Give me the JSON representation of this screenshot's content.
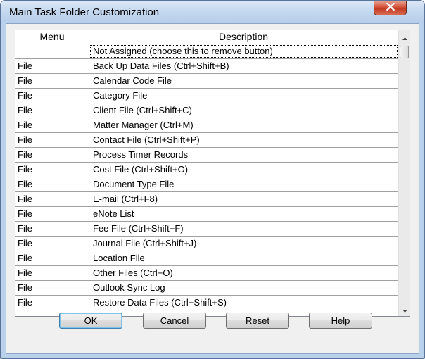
{
  "window": {
    "title": "Main Task Folder Customization",
    "close_symbol": "✕"
  },
  "table": {
    "columns": [
      "Menu",
      "Description"
    ],
    "rows": [
      {
        "menu": "",
        "description": "Not Assigned (choose this to remove button)"
      },
      {
        "menu": "File",
        "description": "Back Up Data Files (Ctrl+Shift+B)"
      },
      {
        "menu": "File",
        "description": "Calendar Code File"
      },
      {
        "menu": "File",
        "description": "Category File"
      },
      {
        "menu": "File",
        "description": "Client File (Ctrl+Shift+C)"
      },
      {
        "menu": "File",
        "description": "Matter Manager (Ctrl+M)"
      },
      {
        "menu": "File",
        "description": "Contact File (Ctrl+Shift+P)"
      },
      {
        "menu": "File",
        "description": "Process Timer Records"
      },
      {
        "menu": "File",
        "description": "Cost File (Ctrl+Shift+O)"
      },
      {
        "menu": "File",
        "description": "Document Type File"
      },
      {
        "menu": "File",
        "description": "E-mail (Ctrl+F8)"
      },
      {
        "menu": "File",
        "description": "eNote List"
      },
      {
        "menu": "File",
        "description": "Fee File (Ctrl+Shift+F)"
      },
      {
        "menu": "File",
        "description": "Journal File (Ctrl+Shift+J)"
      },
      {
        "menu": "File",
        "description": "Location File"
      },
      {
        "menu": "File",
        "description": "Other Files (Ctrl+O)"
      },
      {
        "menu": "File",
        "description": "Outlook Sync Log"
      },
      {
        "menu": "File",
        "description": "Restore Data Files (Ctrl+Shift+S)"
      }
    ]
  },
  "buttons": {
    "ok": "OK",
    "cancel": "Cancel",
    "reset": "Reset",
    "help": "Help"
  },
  "icons": {
    "close": "close-icon",
    "scroll_up": "arrow-up-icon",
    "scroll_down": "arrow-down-icon"
  },
  "colors": {
    "title_bar": "#c4d8ef",
    "close_button": "#c23b22",
    "dialog_background": "#f0f0f0"
  }
}
